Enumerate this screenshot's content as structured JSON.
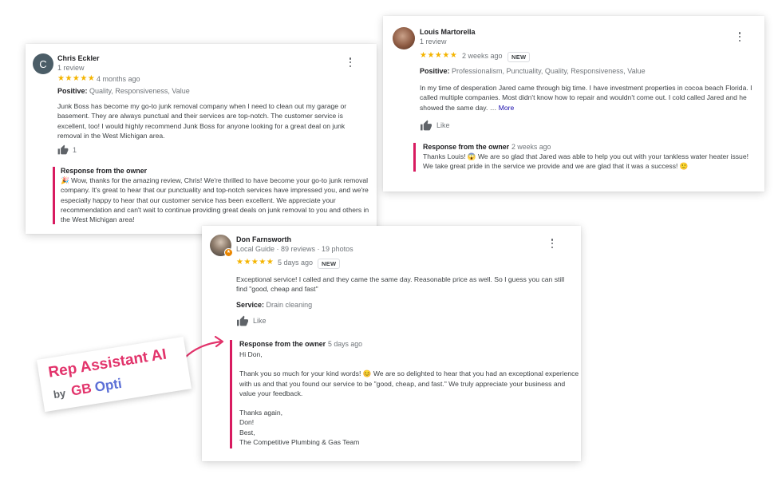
{
  "reviews": {
    "chris": {
      "name": "Chris Eckler",
      "count": "1 review",
      "initial": "C",
      "stars": "★★★★★",
      "time": "4 months ago",
      "positive_label": "Positive:",
      "positive_values": "Quality, Responsiveness, Value",
      "body": "Junk Boss has become my go-to junk removal company when I need to clean out my garage or basement. They are always punctual and their services are top-notch. The customer service is excellent, too! I would highly recommend Junk Boss for anyone looking for a great deal on junk removal in the West Michigan area.",
      "like_count": "1",
      "response_title": "Response from the owner",
      "response_time": "",
      "response_text": "🎉 Wow, thanks for the amazing review, Chris! We're thrilled to have become your go-to junk removal company. It's great to hear that our punctuality and top-notch services have impressed you, and we're especially happy to hear that our customer service has been excellent. We appreciate your recommendation and can't wait to continue providing great deals on junk removal to you and others in the West Michigan area!"
    },
    "louis": {
      "name": "Louis Martorella",
      "count": "1 review",
      "stars": "★★★★★",
      "time": "2 weeks ago",
      "badge": "NEW",
      "positive_label": "Positive:",
      "positive_values": "Professionalism, Punctuality, Quality, Responsiveness, Value",
      "body": "In my time of desperation Jared came through big time. I have investment properties in cocoa beach Florida. I called multiple companies. Most didn't know how to repair and wouldn't come out. I cold called Jared and he showed the same day. …",
      "more": "More",
      "like_label": "Like",
      "response_title": "Response from the owner",
      "response_time": "2 weeks ago",
      "response_text": "Thanks Louis! 😱 We are so glad that Jared was able to help you out with your tankless water heater issue! We take great pride in the service we provide and we are glad that it was a success! 🙂"
    },
    "don": {
      "name": "Don Farnsworth",
      "guide": "Local Guide · 89 reviews · 19 photos",
      "stars": "★★★★★",
      "time": "5 days ago",
      "badge": "NEW",
      "body": "Exceptional service!  I called and they came the same day. Reasonable price as well. So I guess you can still find \"good, cheap and fast\"",
      "service_label": "Service:",
      "service_value": "Drain cleaning",
      "like_label": "Like",
      "response_title": "Response from the owner",
      "response_time": "5 days ago",
      "response_lines": [
        "Hi Don,",
        "Thank you so much for your kind words! 😊 We are so delighted to hear that you had an exceptional experience with us and that you found our service to be \"good, cheap, and fast.\" We truly appreciate your business and value your feedback.",
        "Thanks again,",
        "Don!",
        "Best,",
        "The Competitive Plumbing & Gas Team"
      ]
    }
  },
  "brand": {
    "line1": "Rep Assistant AI",
    "by": "by",
    "name_part1": "GB",
    "name_part2": "Opti",
    "pink": "#e2336b",
    "blue": "#5b6fd6"
  },
  "colors": {
    "star": "#f4b400",
    "accent": "#d81b60",
    "link": "#1a0dab"
  }
}
